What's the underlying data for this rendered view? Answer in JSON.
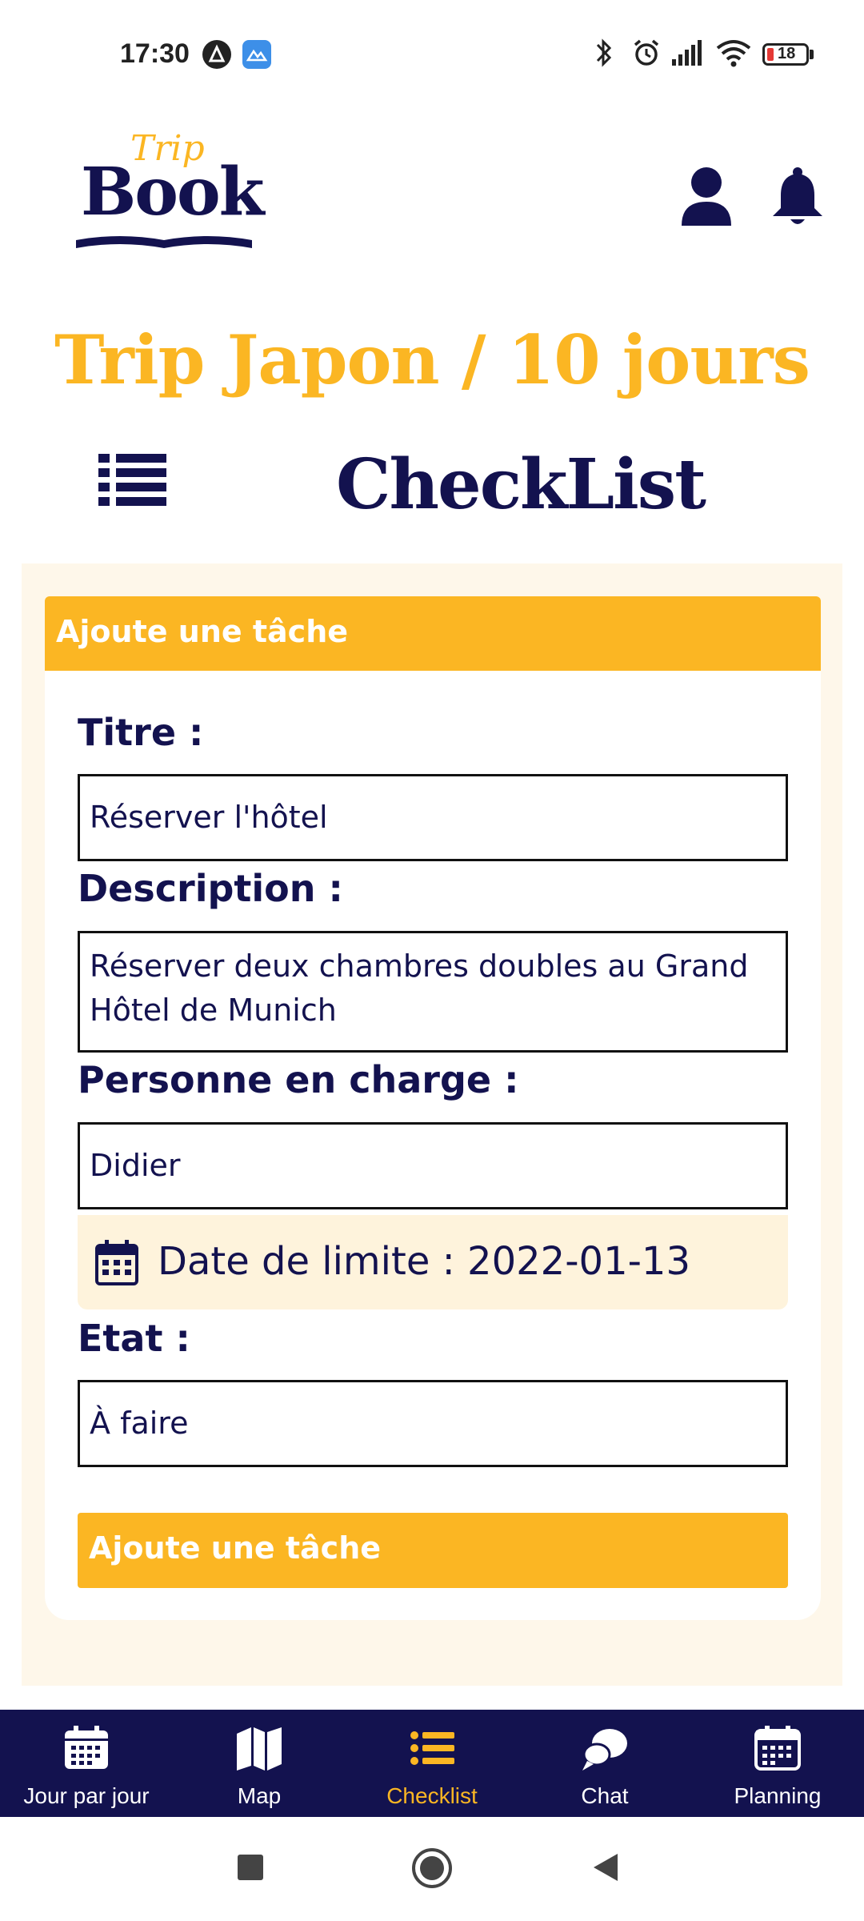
{
  "status_bar": {
    "time": "17:30",
    "battery": "18"
  },
  "app": {
    "logo_trip": "Trip",
    "logo_book": "Book"
  },
  "header": {
    "trip_title": "Trip Japon / 10 jours",
    "section_title": "CheckList"
  },
  "form": {
    "header_label": "Ajoute une tâche",
    "title_label": "Titre :",
    "title_value": "Réserver l'hôtel",
    "description_label": "Description :",
    "description_value": "Réserver deux chambres doubles au Grand Hôtel de Munich",
    "owner_label": "Personne en charge :",
    "owner_value": "Didier",
    "deadline_label": "Date de limite : 2022-01-13",
    "state_label": "Etat :",
    "state_value": "À faire",
    "submit_label": "Ajoute une tâche"
  },
  "bottom_nav": {
    "items": [
      {
        "label": "Jour par jour",
        "icon": "calendar-grid-icon"
      },
      {
        "label": "Map",
        "icon": "map-icon"
      },
      {
        "label": "Checklist",
        "icon": "list-icon",
        "active": true
      },
      {
        "label": "Chat",
        "icon": "chat-bubbles-icon"
      },
      {
        "label": "Planning",
        "icon": "calendar-icon"
      }
    ]
  },
  "colors": {
    "primary": "#13124f",
    "accent": "#fbb623",
    "panel_bg": "#fef7ea",
    "date_bg": "#fef3dc"
  }
}
